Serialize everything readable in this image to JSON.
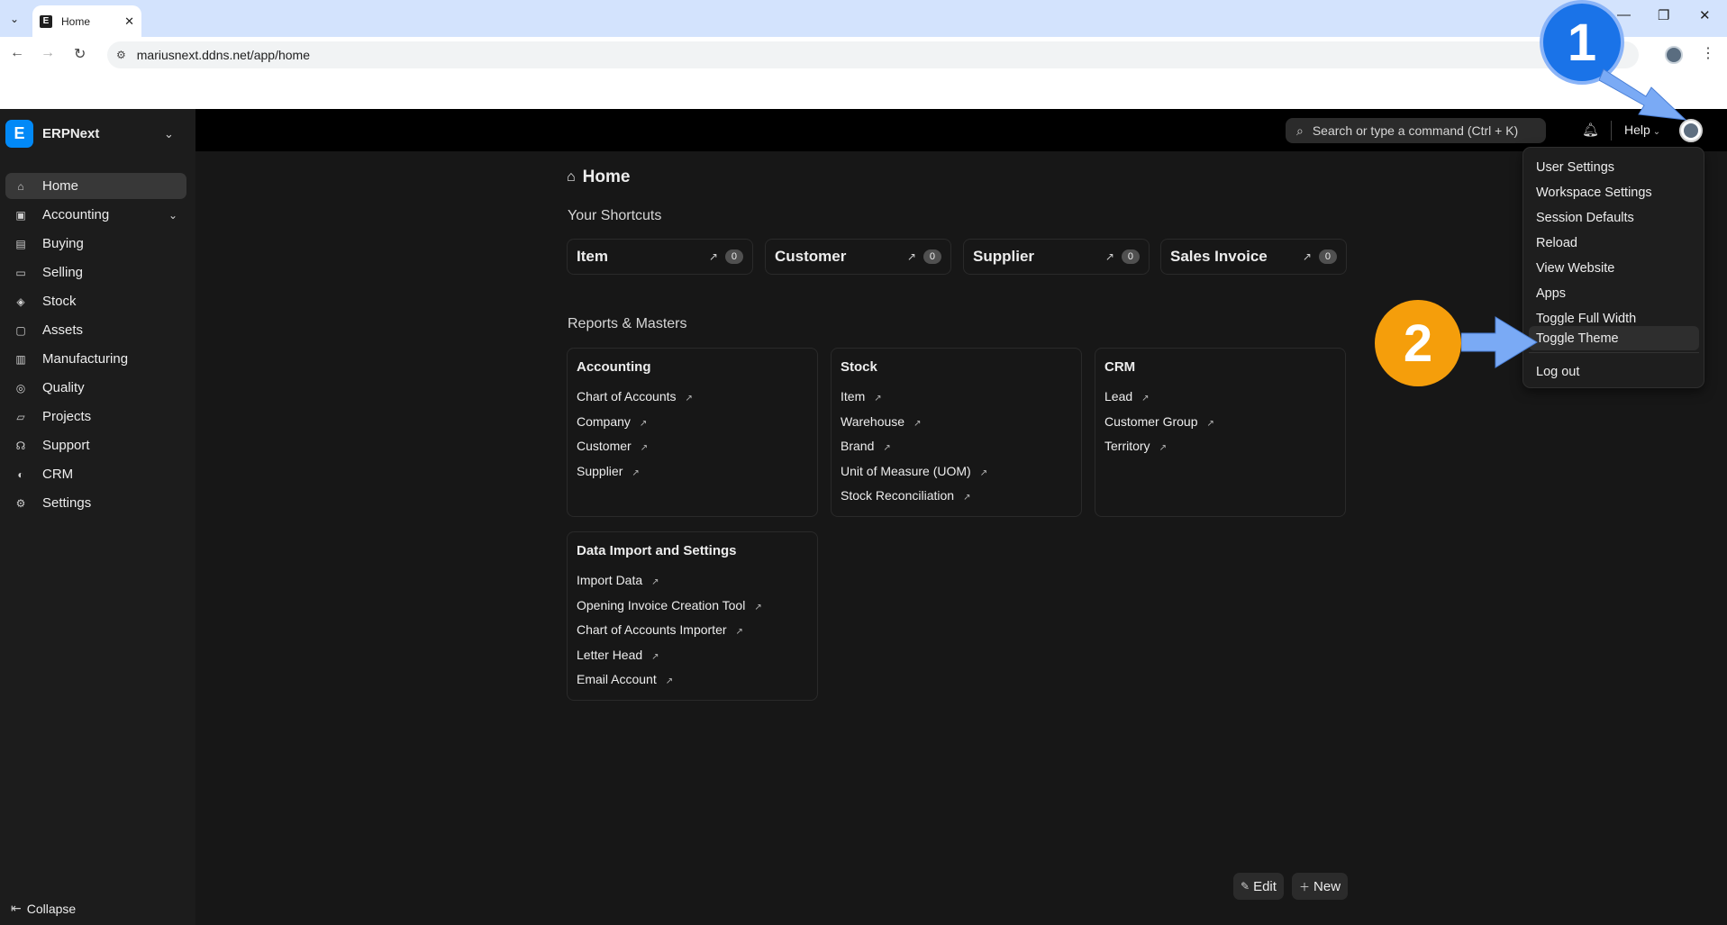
{
  "browser": {
    "tab_title": "Home",
    "favicon_letter": "E",
    "url": "mariusnext.ddns.net/app/home"
  },
  "app": {
    "brand_name": "ERPNext",
    "brand_letter": "E",
    "search_placeholder": "Search or type a command (Ctrl + K)",
    "help_label": "Help"
  },
  "sidebar": {
    "items": [
      {
        "label": "Home",
        "icon": "home-icon"
      },
      {
        "label": "Accounting",
        "icon": "accounting-icon"
      },
      {
        "label": "Buying",
        "icon": "buying-icon"
      },
      {
        "label": "Selling",
        "icon": "selling-icon"
      },
      {
        "label": "Stock",
        "icon": "stock-icon"
      },
      {
        "label": "Assets",
        "icon": "assets-icon"
      },
      {
        "label": "Manufacturing",
        "icon": "manufacturing-icon"
      },
      {
        "label": "Quality",
        "icon": "quality-icon"
      },
      {
        "label": "Projects",
        "icon": "projects-icon"
      },
      {
        "label": "Support",
        "icon": "support-icon"
      },
      {
        "label": "CRM",
        "icon": "crm-icon"
      },
      {
        "label": "Settings",
        "icon": "settings-icon"
      }
    ],
    "collapse_label": "Collapse"
  },
  "main": {
    "page_title": "Home",
    "shortcuts_title": "Your Shortcuts",
    "shortcuts": [
      {
        "label": "Item",
        "count": "0"
      },
      {
        "label": "Customer",
        "count": "0"
      },
      {
        "label": "Supplier",
        "count": "0"
      },
      {
        "label": "Sales Invoice",
        "count": "0"
      }
    ],
    "reports_title": "Reports & Masters",
    "cards": [
      {
        "title": "Accounting",
        "links": [
          "Chart of Accounts",
          "Company",
          "Customer",
          "Supplier"
        ]
      },
      {
        "title": "Stock",
        "links": [
          "Item",
          "Warehouse",
          "Brand",
          "Unit of Measure (UOM)",
          "Stock Reconciliation"
        ]
      },
      {
        "title": "CRM",
        "links": [
          "Lead",
          "Customer Group",
          "Territory"
        ]
      },
      {
        "title": "Data Import and Settings",
        "links": [
          "Import Data",
          "Opening Invoice Creation Tool",
          "Chart of Accounts Importer",
          "Letter Head",
          "Email Account"
        ]
      }
    ],
    "edit_label": "Edit",
    "new_label": "New"
  },
  "user_menu": {
    "items": [
      "User Settings",
      "Workspace Settings",
      "Session Defaults",
      "Reload",
      "View Website",
      "Apps",
      "Toggle Full Width",
      "Toggle Theme"
    ],
    "logout": "Log out"
  },
  "annotations": {
    "step1": "1",
    "step2": "2"
  },
  "colors": {
    "brand": "#0289f7",
    "step1_badge": "#1a73e8",
    "step2_badge": "#f59e0b",
    "arrow": "#7aaaf5"
  }
}
